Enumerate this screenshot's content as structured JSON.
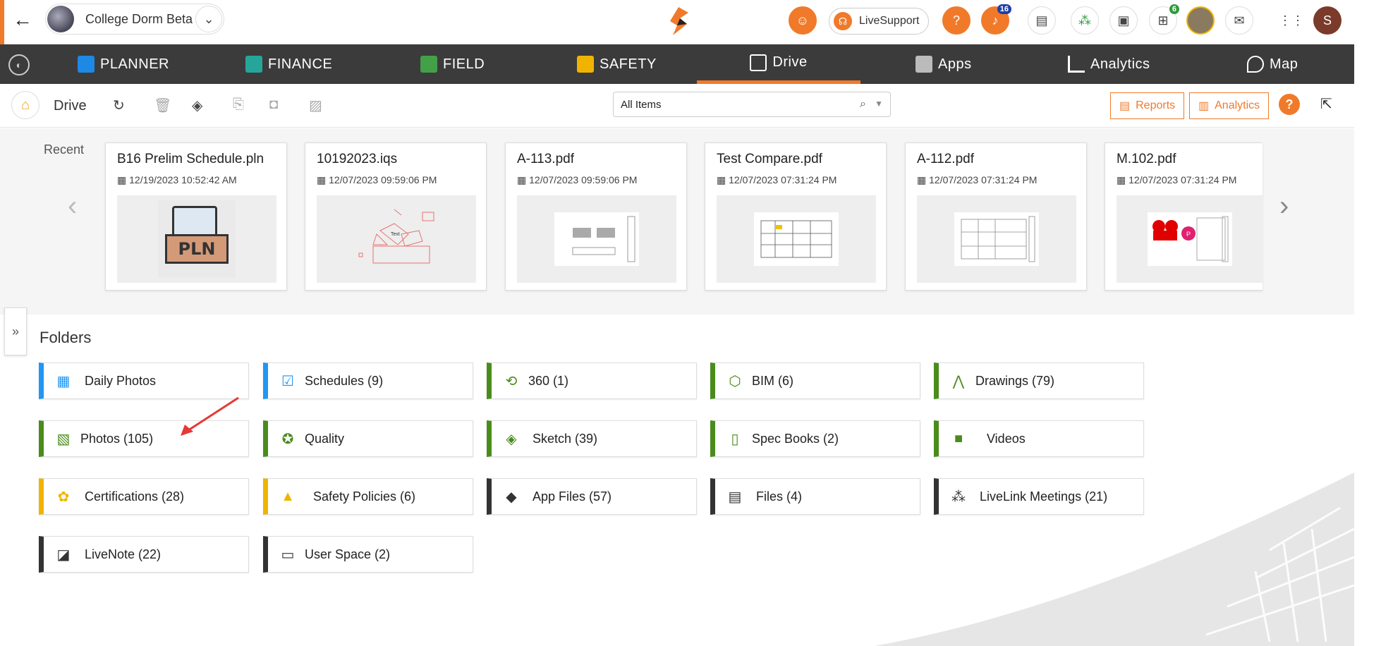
{
  "header": {
    "project_name": "College Dorm Beta",
    "live_support": "LiveSupport",
    "notif_count": "16",
    "cart_count": "6",
    "user_initial": "S"
  },
  "nav": {
    "items": [
      {
        "label": "PLANNER",
        "color": "#1e88e5"
      },
      {
        "label": "FINANCE",
        "color": "#26a69a"
      },
      {
        "label": "FIELD",
        "color": "#43a047"
      },
      {
        "label": "SAFETY",
        "color": "#f0b400"
      },
      {
        "label": "Drive",
        "active": true
      },
      {
        "label": "Apps"
      },
      {
        "label": "Analytics"
      },
      {
        "label": "Map"
      }
    ],
    "accent": "#f07a2a"
  },
  "toolbar": {
    "title": "Drive",
    "search_value": "All Items",
    "reports_label": "Reports",
    "analytics_label": "Analytics"
  },
  "recent": {
    "label": "Recent",
    "cards": [
      {
        "title": "B16 Prelim Schedule.pln",
        "date": "12/19/2023 10:52:42 AM",
        "thumb": "PLN"
      },
      {
        "title": "10192023.iqs",
        "date": "12/07/2023 09:59:06 PM",
        "thumb_text": "Text"
      },
      {
        "title": "A-113.pdf",
        "date": "12/07/2023 09:59:06 PM"
      },
      {
        "title": "Test Compare.pdf",
        "date": "12/07/2023 07:31:24 PM"
      },
      {
        "title": "A-112.pdf",
        "date": "12/07/2023 07:31:24 PM"
      },
      {
        "title": "M.102.pdf",
        "date": "12/07/2023 07:31:24 PM",
        "marker": "P"
      }
    ]
  },
  "folders": {
    "title": "Folders",
    "items": [
      {
        "label": "Daily Photos",
        "icon": "calendar-camera-icon",
        "color": "#2196f3"
      },
      {
        "label": "Schedules (9)",
        "icon": "calendar-check-icon",
        "color": "#2196f3"
      },
      {
        "label": "360 (1)",
        "icon": "rotate-360-icon",
        "color": "#4a8c1c"
      },
      {
        "label": "BIM (6)",
        "icon": "cube-icon",
        "color": "#4a8c1c"
      },
      {
        "label": "Drawings (79)",
        "icon": "compass-icon",
        "color": "#4a8c1c"
      },
      {
        "label": "Photos (105)",
        "icon": "image-icon",
        "color": "#4a8c1c"
      },
      {
        "label": "Quality",
        "icon": "award-icon",
        "color": "#4a8c1c"
      },
      {
        "label": "Sketch (39)",
        "icon": "sketch-icon",
        "color": "#4a8c1c"
      },
      {
        "label": "Spec Books (2)",
        "icon": "book-icon",
        "color": "#4a8c1c"
      },
      {
        "label": "Videos",
        "icon": "video-icon",
        "color": "#4a8c1c"
      },
      {
        "label": "Certifications (28)",
        "icon": "certificate-icon",
        "color": "#f0b400"
      },
      {
        "label": "Safety Policies (6)",
        "icon": "cone-icon",
        "color": "#f0b400"
      },
      {
        "label": "App Files (57)",
        "icon": "app-logo-icon",
        "color": "#333333"
      },
      {
        "label": "Files (4)",
        "icon": "file-icon",
        "color": "#333333"
      },
      {
        "label": "LiveLink Meetings (21)",
        "icon": "meeting-icon",
        "color": "#333333"
      },
      {
        "label": "LiveNote (22)",
        "icon": "note-icon",
        "color": "#333333"
      },
      {
        "label": "User Space (2)",
        "icon": "drive-icon",
        "color": "#333333"
      }
    ]
  }
}
